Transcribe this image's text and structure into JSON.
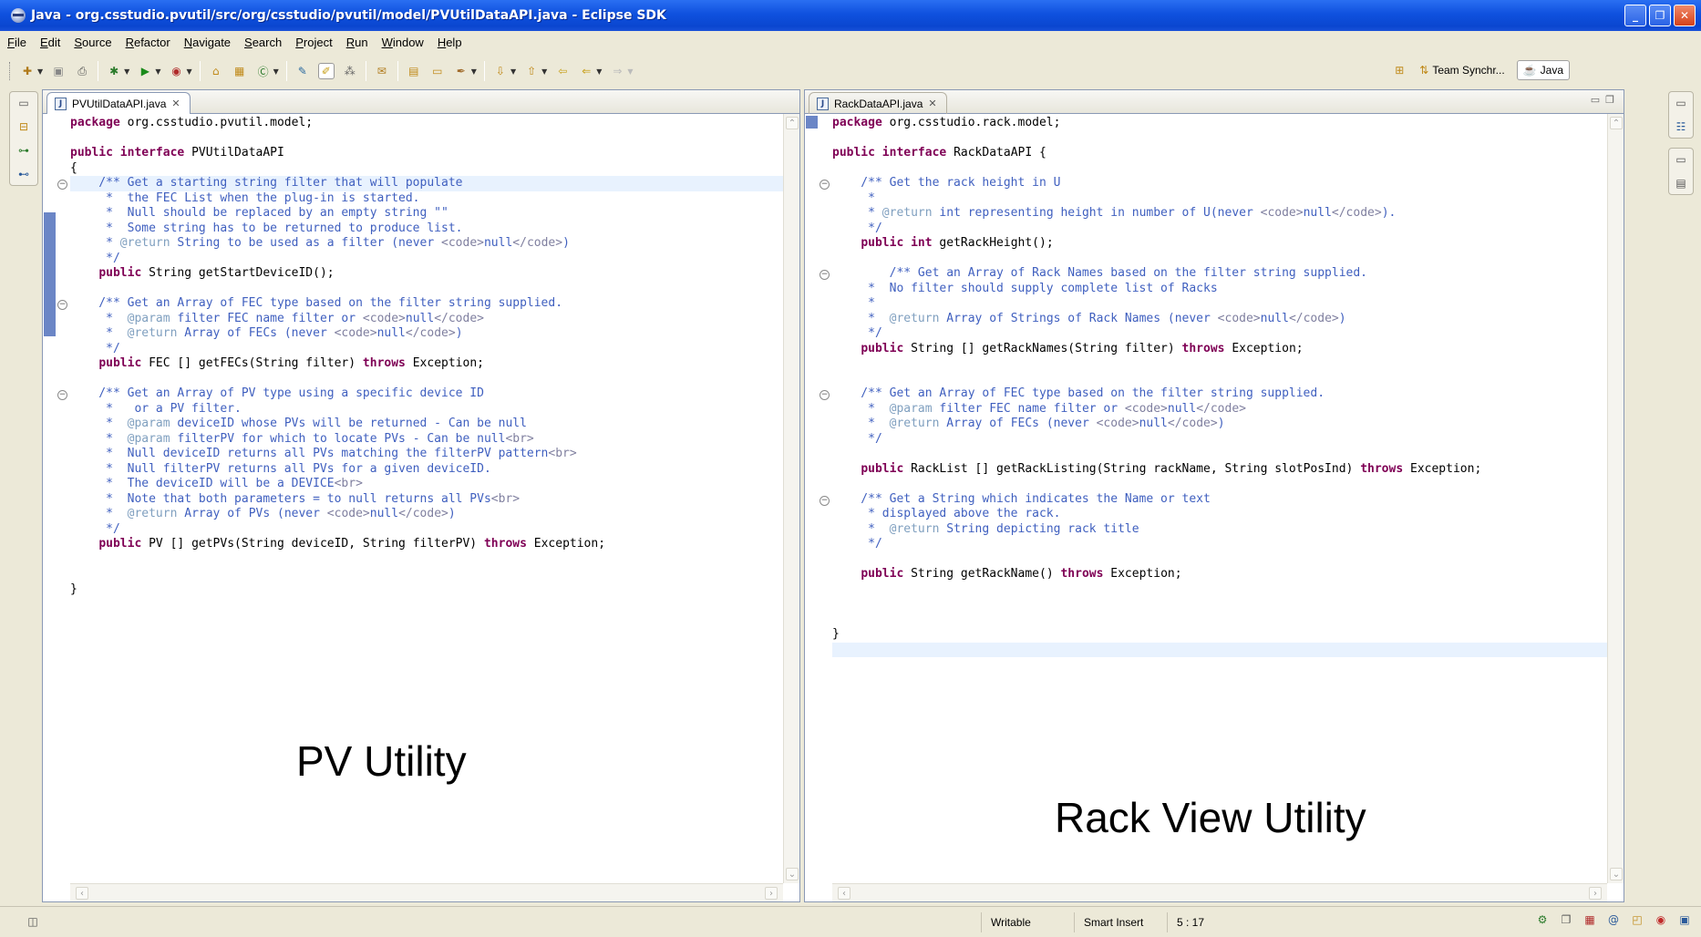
{
  "window": {
    "title": "Java - org.csstudio.pvutil/src/org/csstudio/pvutil/model/PVUtilDataAPI.java - Eclipse SDK",
    "buttons": {
      "minimize": "_",
      "restore": "❐",
      "close": "✕"
    }
  },
  "menu": [
    "File",
    "Edit",
    "Source",
    "Refactor",
    "Navigate",
    "Search",
    "Project",
    "Run",
    "Window",
    "Help"
  ],
  "perspectives": {
    "team": "Team Synchr...",
    "java": "Java"
  },
  "left_editor": {
    "tab_label": "PVUtilDataAPI.java",
    "overlay": "PV Utility",
    "lines": [
      [
        {
          "t": "package ",
          "c": "kw"
        },
        {
          "t": "org.csstudio.pvutil.model;",
          "c": ""
        }
      ],
      [],
      [
        {
          "t": "public ",
          "c": "kw"
        },
        {
          "t": "interface ",
          "c": "kw"
        },
        {
          "t": "PVUtilDataAPI",
          "c": ""
        }
      ],
      [
        {
          "t": "{",
          "c": ""
        }
      ],
      [
        {
          "t": "    /** Get a starting string filter that will populate",
          "c": "jd"
        }
      ],
      [
        {
          "t": "     *  the FEC List when the plug-in is started.",
          "c": "jd"
        }
      ],
      [
        {
          "t": "     *  Null should be replaced by an empty string \"\"",
          "c": "jd"
        }
      ],
      [
        {
          "t": "     *  Some string has to be returned to produce list.",
          "c": "jd"
        }
      ],
      [
        {
          "t": "     * ",
          "c": "jd"
        },
        {
          "t": "@return",
          "c": "jt"
        },
        {
          "t": " String to be used as a filter (never ",
          "c": "jd"
        },
        {
          "t": "<code>",
          "c": "jtag"
        },
        {
          "t": "null",
          "c": "jd"
        },
        {
          "t": "</code>",
          "c": "jtag"
        },
        {
          "t": ")",
          "c": "jd"
        }
      ],
      [
        {
          "t": "     */",
          "c": "jd"
        }
      ],
      [
        {
          "t": "    ",
          "c": ""
        },
        {
          "t": "public ",
          "c": "kw"
        },
        {
          "t": "String getStartDeviceID();",
          "c": ""
        }
      ],
      [],
      [
        {
          "t": "    /** Get an Array of FEC type based on the filter string supplied.",
          "c": "jd"
        }
      ],
      [
        {
          "t": "     *  ",
          "c": "jd"
        },
        {
          "t": "@param",
          "c": "jt"
        },
        {
          "t": " filter FEC name filter or ",
          "c": "jd"
        },
        {
          "t": "<code>",
          "c": "jtag"
        },
        {
          "t": "null",
          "c": "jd"
        },
        {
          "t": "</code>",
          "c": "jtag"
        }
      ],
      [
        {
          "t": "     *  ",
          "c": "jd"
        },
        {
          "t": "@return",
          "c": "jt"
        },
        {
          "t": " Array of FECs (never ",
          "c": "jd"
        },
        {
          "t": "<code>",
          "c": "jtag"
        },
        {
          "t": "null",
          "c": "jd"
        },
        {
          "t": "</code>",
          "c": "jtag"
        },
        {
          "t": ")",
          "c": "jd"
        }
      ],
      [
        {
          "t": "     */",
          "c": "jd"
        }
      ],
      [
        {
          "t": "    ",
          "c": ""
        },
        {
          "t": "public ",
          "c": "kw"
        },
        {
          "t": "FEC [] getFECs(String filter) ",
          "c": ""
        },
        {
          "t": "throws ",
          "c": "kw"
        },
        {
          "t": "Exception;",
          "c": ""
        }
      ],
      [],
      [
        {
          "t": "    /** Get an Array of PV type using a specific device ID",
          "c": "jd"
        }
      ],
      [
        {
          "t": "     *   or a PV filter.",
          "c": "jd"
        }
      ],
      [
        {
          "t": "     *  ",
          "c": "jd"
        },
        {
          "t": "@param",
          "c": "jt"
        },
        {
          "t": " deviceID whose PVs will be returned - Can be null",
          "c": "jd"
        }
      ],
      [
        {
          "t": "     *  ",
          "c": "jd"
        },
        {
          "t": "@param",
          "c": "jt"
        },
        {
          "t": " filterPV for which to locate PVs - Can be null",
          "c": "jd"
        },
        {
          "t": "<br>",
          "c": "jtag"
        }
      ],
      [
        {
          "t": "     *  Null deviceID returns all PVs matching the filterPV pattern",
          "c": "jd"
        },
        {
          "t": "<br>",
          "c": "jtag"
        }
      ],
      [
        {
          "t": "     *  Null filterPV returns all PVs for a given deviceID.",
          "c": "jd"
        }
      ],
      [
        {
          "t": "     *  The deviceID will be a DEVICE",
          "c": "jd"
        },
        {
          "t": "<br>",
          "c": "jtag"
        }
      ],
      [
        {
          "t": "     *  Note that both parameters = to null returns all PVs",
          "c": "jd"
        },
        {
          "t": "<br>",
          "c": "jtag"
        }
      ],
      [
        {
          "t": "     *  ",
          "c": "jd"
        },
        {
          "t": "@return",
          "c": "jt"
        },
        {
          "t": " Array of PVs (never ",
          "c": "jd"
        },
        {
          "t": "<code>",
          "c": "jtag"
        },
        {
          "t": "null",
          "c": "jd"
        },
        {
          "t": "</code>",
          "c": "jtag"
        },
        {
          "t": ")",
          "c": "jd"
        }
      ],
      [
        {
          "t": "     */",
          "c": "jd"
        }
      ],
      [
        {
          "t": "    ",
          "c": ""
        },
        {
          "t": "public ",
          "c": "kw"
        },
        {
          "t": "PV [] getPVs(String deviceID, String filterPV) ",
          "c": ""
        },
        {
          "t": "throws ",
          "c": "kw"
        },
        {
          "t": "Exception;",
          "c": ""
        }
      ],
      [],
      [],
      [
        {
          "t": "}",
          "c": ""
        }
      ]
    ]
  },
  "right_editor": {
    "tab_label": "RackDataAPI.java",
    "overlay": "Rack View Utility",
    "lines": [
      [
        {
          "t": "package ",
          "c": "kw"
        },
        {
          "t": "org.csstudio.rack.model;",
          "c": ""
        }
      ],
      [],
      [
        {
          "t": "public ",
          "c": "kw"
        },
        {
          "t": "interface ",
          "c": "kw"
        },
        {
          "t": "RackDataAPI {",
          "c": ""
        }
      ],
      [],
      [
        {
          "t": "    /** Get the rack height in U",
          "c": "jd"
        }
      ],
      [
        {
          "t": "     *",
          "c": "jd"
        }
      ],
      [
        {
          "t": "     * ",
          "c": "jd"
        },
        {
          "t": "@return",
          "c": "jt"
        },
        {
          "t": " int representing height in number of U(never ",
          "c": "jd"
        },
        {
          "t": "<code>",
          "c": "jtag"
        },
        {
          "t": "null",
          "c": "jd"
        },
        {
          "t": "</code>",
          "c": "jtag"
        },
        {
          "t": ").",
          "c": "jd"
        }
      ],
      [
        {
          "t": "     */",
          "c": "jd"
        }
      ],
      [
        {
          "t": "    ",
          "c": ""
        },
        {
          "t": "public ",
          "c": "kw"
        },
        {
          "t": "int ",
          "c": "kw"
        },
        {
          "t": "getRackHeight();",
          "c": ""
        }
      ],
      [],
      [
        {
          "t": "        /** Get an Array of Rack Names based on the filter string supplied.",
          "c": "jd"
        }
      ],
      [
        {
          "t": "     *  No filter should supply complete list of Racks",
          "c": "jd"
        }
      ],
      [
        {
          "t": "     *",
          "c": "jd"
        }
      ],
      [
        {
          "t": "     *  ",
          "c": "jd"
        },
        {
          "t": "@return",
          "c": "jt"
        },
        {
          "t": " Array of Strings of Rack Names (never ",
          "c": "jd"
        },
        {
          "t": "<code>",
          "c": "jtag"
        },
        {
          "t": "null",
          "c": "jd"
        },
        {
          "t": "</code>",
          "c": "jtag"
        },
        {
          "t": ")",
          "c": "jd"
        }
      ],
      [
        {
          "t": "     */",
          "c": "jd"
        }
      ],
      [
        {
          "t": "    ",
          "c": ""
        },
        {
          "t": "public ",
          "c": "kw"
        },
        {
          "t": "String [] getRackNames(String filter) ",
          "c": ""
        },
        {
          "t": "throws ",
          "c": "kw"
        },
        {
          "t": "Exception;",
          "c": ""
        }
      ],
      [],
      [],
      [
        {
          "t": "    /** Get an Array of FEC type based on the filter string supplied.",
          "c": "jd"
        }
      ],
      [
        {
          "t": "     *  ",
          "c": "jd"
        },
        {
          "t": "@param",
          "c": "jt"
        },
        {
          "t": " filter FEC name filter or ",
          "c": "jd"
        },
        {
          "t": "<code>",
          "c": "jtag"
        },
        {
          "t": "null",
          "c": "jd"
        },
        {
          "t": "</code>",
          "c": "jtag"
        }
      ],
      [
        {
          "t": "     *  ",
          "c": "jd"
        },
        {
          "t": "@return",
          "c": "jt"
        },
        {
          "t": " Array of FECs (never ",
          "c": "jd"
        },
        {
          "t": "<code>",
          "c": "jtag"
        },
        {
          "t": "null",
          "c": "jd"
        },
        {
          "t": "</code>",
          "c": "jtag"
        },
        {
          "t": ")",
          "c": "jd"
        }
      ],
      [
        {
          "t": "     */",
          "c": "jd"
        }
      ],
      [],
      [
        {
          "t": "    ",
          "c": ""
        },
        {
          "t": "public ",
          "c": "kw"
        },
        {
          "t": "RackList [] getRackListing(String rackName, String slotPosInd) ",
          "c": ""
        },
        {
          "t": "throws ",
          "c": "kw"
        },
        {
          "t": "Exception;",
          "c": ""
        }
      ],
      [],
      [
        {
          "t": "    /** Get a String which indicates the Name or text",
          "c": "jd"
        }
      ],
      [
        {
          "t": "     * displayed above the rack.",
          "c": "jd"
        }
      ],
      [
        {
          "t": "     *  ",
          "c": "jd"
        },
        {
          "t": "@return",
          "c": "jt"
        },
        {
          "t": " String depicting rack title",
          "c": "jd"
        }
      ],
      [
        {
          "t": "     */",
          "c": "jd"
        }
      ],
      [],
      [
        {
          "t": "    ",
          "c": ""
        },
        {
          "t": "public ",
          "c": "kw"
        },
        {
          "t": "String getRackName() ",
          "c": ""
        },
        {
          "t": "throws ",
          "c": "kw"
        },
        {
          "t": "Exception;",
          "c": ""
        }
      ],
      [],
      [],
      [],
      [
        {
          "t": "}",
          "c": ""
        }
      ]
    ]
  },
  "status": {
    "writable": "Writable",
    "insert_mode": "Smart Insert",
    "cursor": "5 : 17"
  },
  "colors": {
    "keyword": "#7f0055",
    "javadoc": "#3f5fbf",
    "javadoc_tag": "#7f9fbf",
    "title_bar": "#0a46d0"
  }
}
